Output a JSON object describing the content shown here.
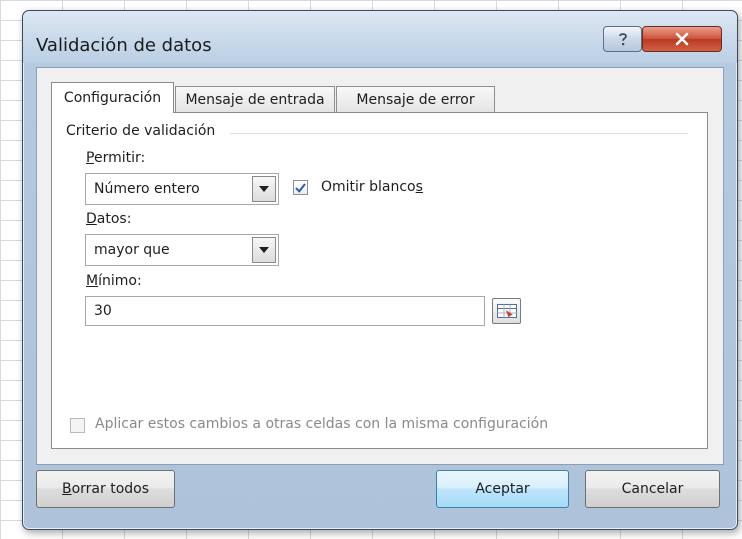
{
  "dialog": {
    "title": "Validación de datos",
    "help_icon": "question-mark-icon",
    "close_icon": "close-x-icon"
  },
  "tabs": [
    {
      "label": "Configuración",
      "active": true
    },
    {
      "label": "Mensaje de entrada",
      "active": false
    },
    {
      "label": "Mensaje de error",
      "active": false
    }
  ],
  "criteria": {
    "group_label": "Criterio de validación",
    "allow_label_key": "P",
    "allow_label_rest": "ermitir:",
    "allow_value": "Número entero",
    "ignore_blank_label_main": "Omitir blanco",
    "ignore_blank_label_key": "s",
    "ignore_blank_checked": true,
    "data_label_key": "D",
    "data_label_rest": "atos:",
    "data_value": "mayor que",
    "minimum_label_key": "M",
    "minimum_label_rest": "ínimo:",
    "minimum_value": "30"
  },
  "apply_all": {
    "label": "Aplicar estos cambios a otras celdas con la misma configuración",
    "checked": false,
    "enabled": false
  },
  "buttons": {
    "clear_all_key": "B",
    "clear_all_rest": "orrar todos",
    "ok": "Aceptar",
    "cancel": "Cancelar"
  },
  "colors": {
    "close_button": "#c9472e",
    "checkmark": "#2a5fa8",
    "default_button_border": "#3c7fb1"
  }
}
